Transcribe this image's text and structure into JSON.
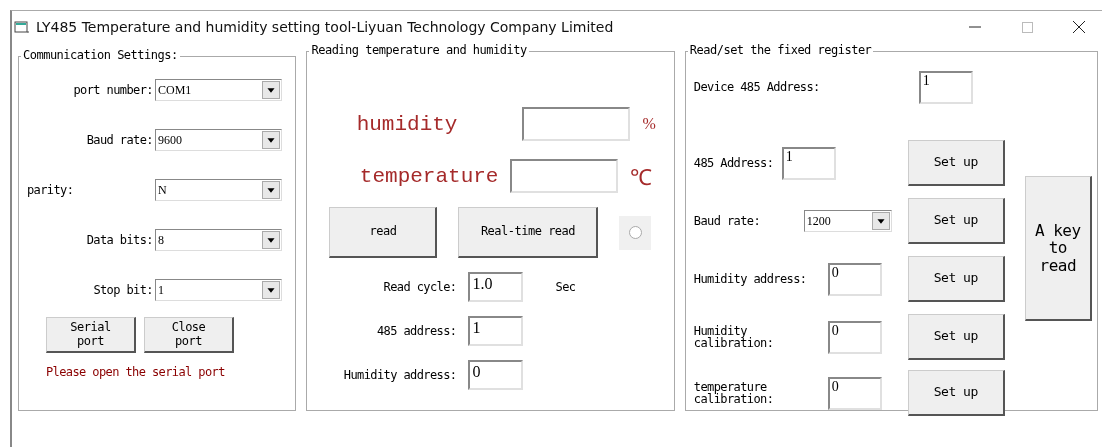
{
  "window": {
    "title": "LY485 Temperature and humidity setting tool-Liyuan Technology Company Limited"
  },
  "communication": {
    "title": "Communication Settings:",
    "fields": [
      {
        "label": "port number:",
        "value": "COM1"
      },
      {
        "label": "Baud rate:",
        "value": "9600"
      },
      {
        "label": "parity:",
        "value": "N"
      },
      {
        "label": "Data bits:",
        "value": "8"
      },
      {
        "label": "Stop bit:",
        "value": "1"
      }
    ],
    "buttons": [
      "Serial port",
      "Close port"
    ],
    "status": "Please open the serial port"
  },
  "reading": {
    "title": "Reading temperature and humidity",
    "readings": [
      {
        "label": "humidity",
        "unit": "%"
      },
      {
        "label": "temperature",
        "unit": "℃"
      }
    ],
    "buttons": [
      "read",
      "Real-time read"
    ],
    "realtime_radio": {
      "selected": false
    },
    "params": [
      {
        "label": "Read cycle:",
        "value": "1.0",
        "unit": "Sec"
      },
      {
        "label": "485 address:",
        "value": "1"
      },
      {
        "label": "Humidity address:",
        "value": "0"
      }
    ]
  },
  "register": {
    "title": "Read/set the fixed register",
    "device_address": {
      "label": "Device 485 Address:",
      "value": "1"
    },
    "rows": [
      {
        "kind": "text",
        "label": "485 Address:",
        "value": "1",
        "button": "Set up"
      },
      {
        "kind": "select",
        "label": "Baud rate:",
        "value": "1200",
        "button": "Set up"
      },
      {
        "kind": "text",
        "label": "Humidity address:",
        "value": "0",
        "button": "Set up"
      },
      {
        "kind": "text",
        "label": "Humidity calibration:",
        "value": "0",
        "button": "Set up"
      },
      {
        "kind": "text",
        "label": "temperature calibration:",
        "value": "0",
        "button": "Set up"
      }
    ],
    "key_button": "A key to read"
  }
}
